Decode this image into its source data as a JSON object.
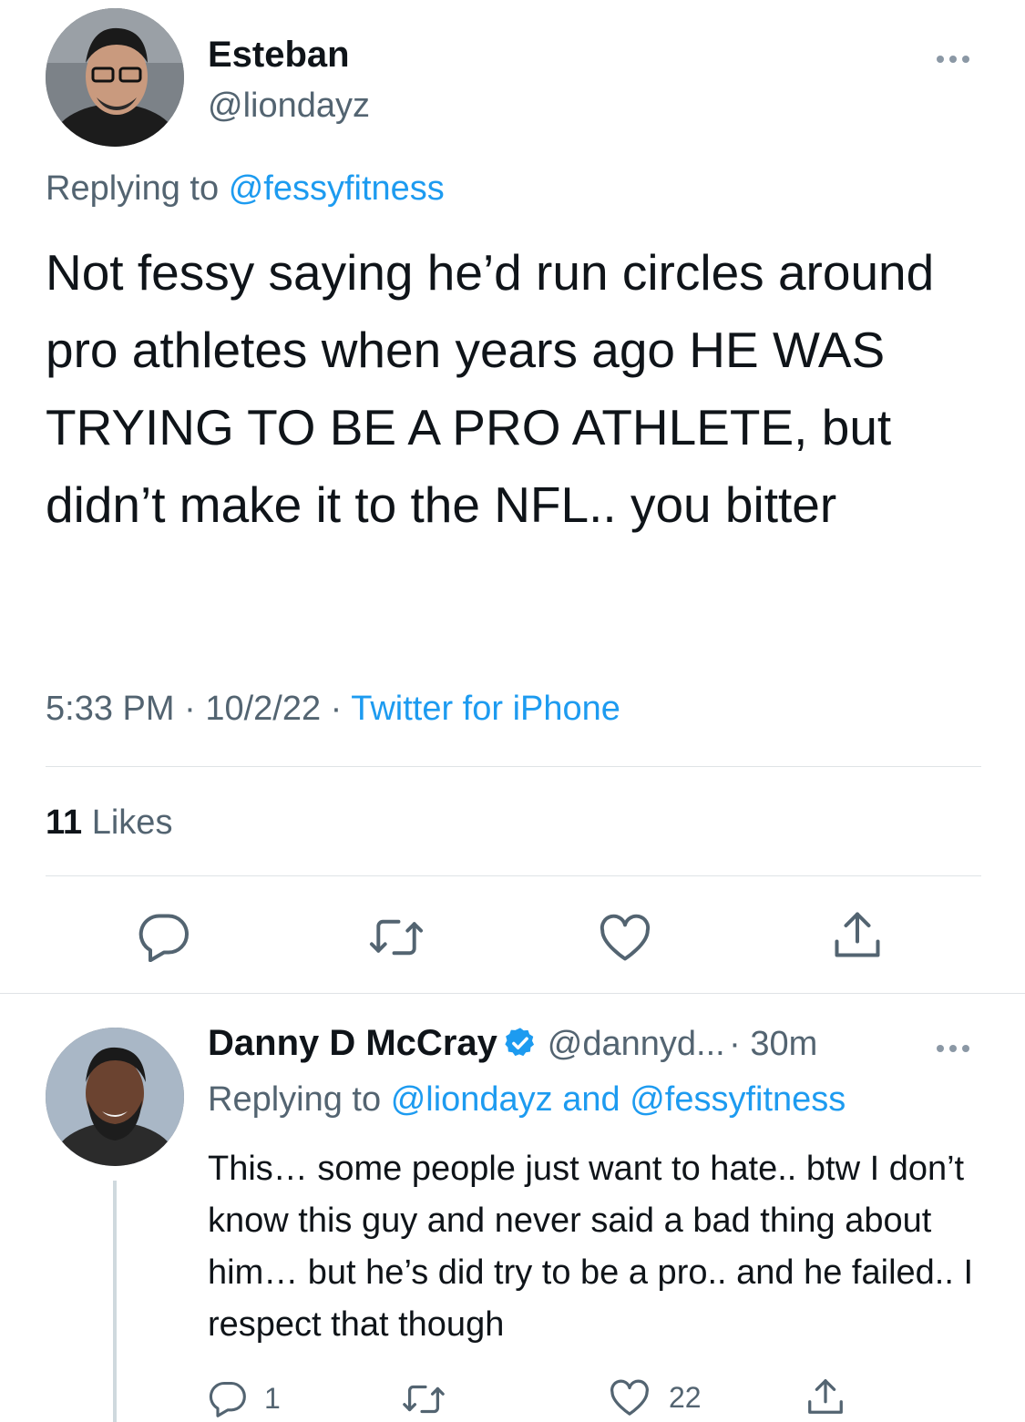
{
  "tweet": {
    "author_name": "Esteban",
    "author_handle": "@liondayz",
    "replying_prefix": "Replying to",
    "replying_to": "@fessyfitness",
    "text": "Not fessy saying he’d run circles around pro athletes when years ago HE WAS TRYING TO BE A PRO ATHLETE, but didn’t make it to the NFL.. you bitter",
    "time": "5:33 PM",
    "sep": "·",
    "date": "10/2/22",
    "source": "Twitter for iPhone",
    "likes_count": "11",
    "likes_label": "Likes"
  },
  "reply": {
    "author_name": "Danny D McCray",
    "author_handle": "@dannyd...",
    "age": "· 30m",
    "replying_prefix": "Replying to",
    "replying_to": "@liondayz and @fessyfitness",
    "text": "This… some people just want to hate.. btw I don’t know this guy and never said a bad thing about him… but he’s did try to be a pro.. and he failed.. I respect that though",
    "reply_count": "1",
    "like_count": "22"
  },
  "colors": {
    "accent": "#1d9bf0",
    "muted": "#536471",
    "text": "#0f1419",
    "divider": "#dfe3e6"
  },
  "icons": [
    "more-icon",
    "reply-icon",
    "retweet-icon",
    "like-icon",
    "share-icon",
    "verified-icon"
  ]
}
